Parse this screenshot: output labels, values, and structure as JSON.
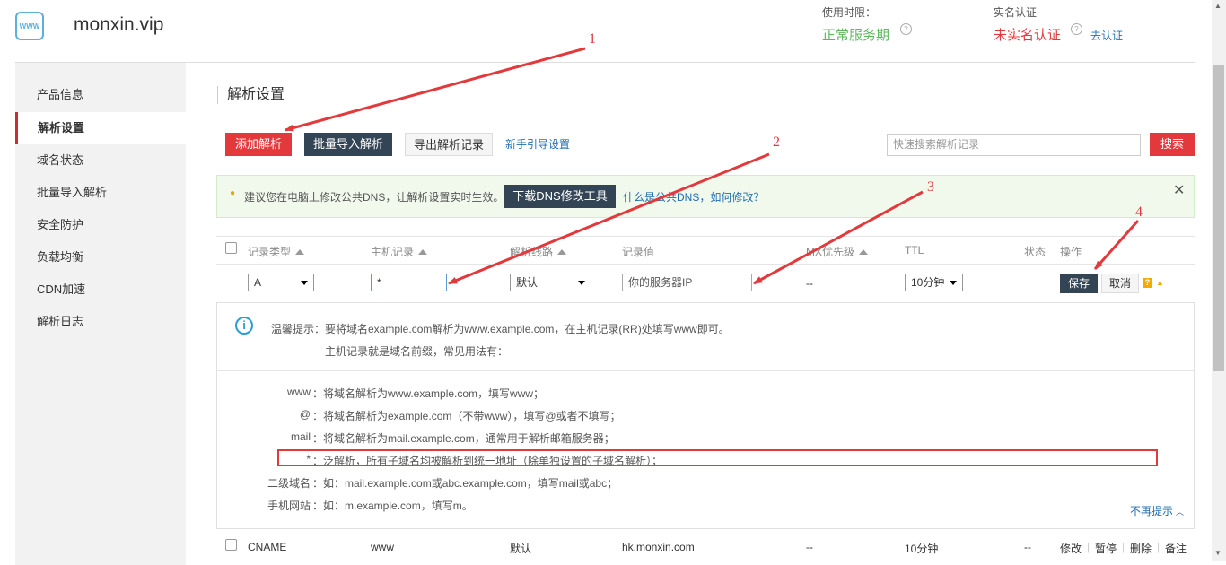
{
  "header": {
    "domain": "monxin.vip",
    "logo_text": "WWW",
    "usage_label": "使用时限：",
    "usage_status": "正常服务期",
    "realname_label": "实名认证",
    "realname_status": "未实名认证",
    "realname_link": "去认证"
  },
  "sidebar": {
    "items": [
      {
        "label": "产品信息"
      },
      {
        "label": "解析设置"
      },
      {
        "label": "域名状态"
      },
      {
        "label": "批量导入解析"
      },
      {
        "label": "安全防护"
      },
      {
        "label": "负载均衡"
      },
      {
        "label": "CDN加速"
      },
      {
        "label": "解析日志"
      }
    ]
  },
  "main": {
    "title": "解析设置",
    "toolbar": {
      "add": "添加解析",
      "batch_import": "批量导入解析",
      "export": "导出解析记录",
      "guide": "新手引导设置",
      "search_placeholder": "快速搜索解析记录",
      "search": "搜索"
    },
    "notice": {
      "text": "建议您在电脑上修改公共DNS，让解析设置实时生效。",
      "download": "下载DNS修改工具",
      "help": "什么是公共DNS，如何修改？",
      "close": "✕"
    },
    "table": {
      "headers": [
        "记录类型",
        "主机记录",
        "解析线路",
        "记录值",
        "MX优先级",
        "TTL",
        "状态",
        "操作"
      ]
    },
    "edit_row": {
      "type": "A",
      "host": "*",
      "line": "默认",
      "value_placeholder": "你的服务器IP",
      "mx": "--",
      "ttl": "10分钟",
      "save": "保存",
      "cancel": "取消",
      "help_icon": "?"
    },
    "tips": {
      "title": "温馨提示：要将域名example.com解析为www.example.com，在主机记录(RR)处填写www即可。",
      "subtitle": "主机记录就是域名前缀，常见用法有：",
      "items": [
        {
          "key": "www",
          "desc": "：将域名解析为www.example.com，填写www；"
        },
        {
          "key": "@",
          "desc": "：将域名解析为example.com（不带www），填写@或者不填写；"
        },
        {
          "key": "mail",
          "desc": "：将域名解析为mail.example.com，通常用于解析邮箱服务器；"
        },
        {
          "key": "*",
          "desc": "：泛解析，所有子域名均被解析到统一地址（除单独设置的子域名解析）；"
        },
        {
          "key": "二级域名",
          "desc": "：如：mail.example.com或abc.example.com，填写mail或abc；"
        },
        {
          "key": "手机网站",
          "desc": "：如：m.example.com，填写m。"
        }
      ],
      "hide": "不再提示"
    },
    "record_row": {
      "type": "CNAME",
      "host": "www",
      "line": "默认",
      "value": "hk.monxin.com",
      "mx": "--",
      "ttl": "10分钟",
      "status": "--",
      "actions": [
        "修改",
        "暂停",
        "删除",
        "备注"
      ]
    }
  },
  "annotations": {
    "labels": [
      "1",
      "2",
      "3",
      "4"
    ],
    "color": "#e4393c"
  }
}
